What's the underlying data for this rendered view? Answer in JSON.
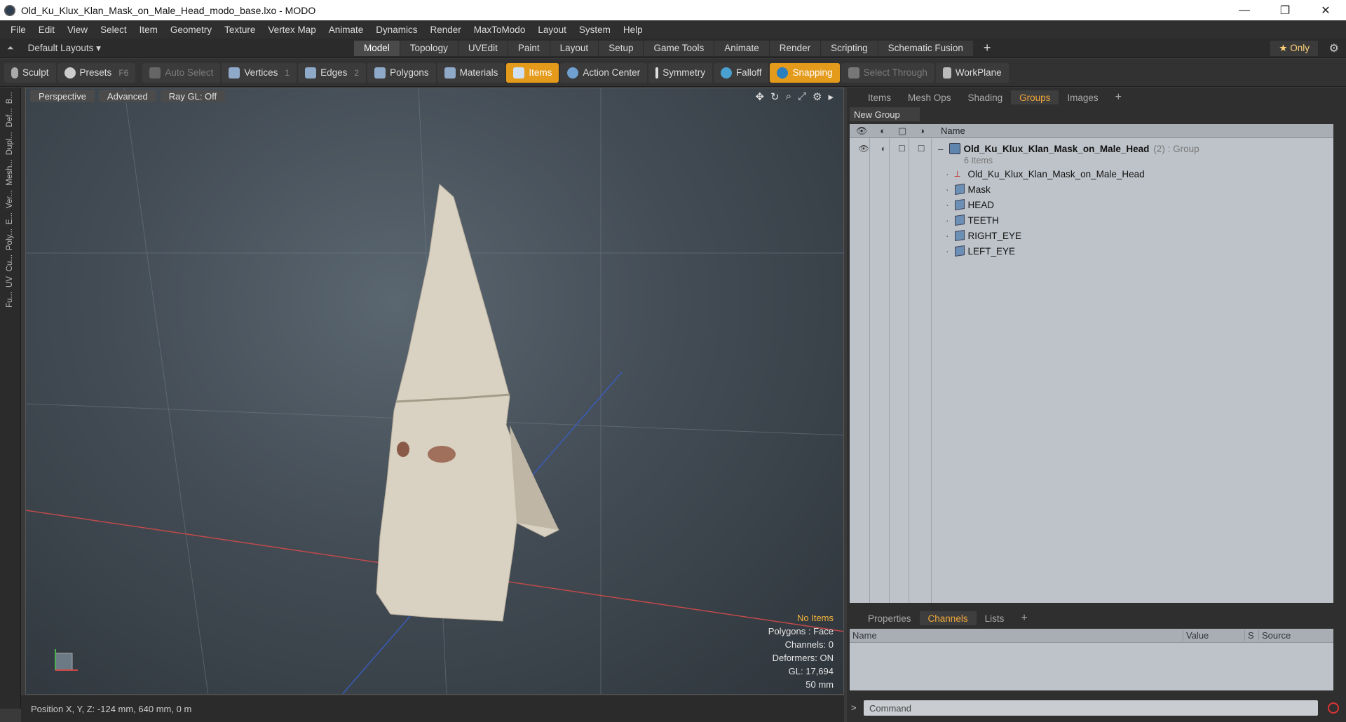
{
  "window": {
    "title": "Old_Ku_Klux_Klan_Mask_on_Male_Head_modo_base.lxo - MODO",
    "controls": [
      "—",
      "❐",
      "✕"
    ]
  },
  "menu": [
    "File",
    "Edit",
    "View",
    "Select",
    "Item",
    "Geometry",
    "Texture",
    "Vertex Map",
    "Animate",
    "Dynamics",
    "Render",
    "MaxToModo",
    "Layout",
    "System",
    "Help"
  ],
  "layouts_label": "Default Layouts ▾",
  "mode_tabs": [
    "Model",
    "Topology",
    "UVEdit",
    "Paint",
    "Layout",
    "Setup",
    "Game Tools",
    "Animate",
    "Render",
    "Scripting",
    "Schematic Fusion"
  ],
  "only_label": "★  Only",
  "toolbar": {
    "sculpt": "Sculpt",
    "presets": "Presets",
    "presets_key": "F6",
    "auto_select": "Auto Select",
    "vertices": "Vertices",
    "vertices_count": "1",
    "edges": "Edges",
    "edges_count": "2",
    "polygons": "Polygons",
    "materials": "Materials",
    "items": "Items",
    "action_center": "Action Center",
    "symmetry": "Symmetry",
    "falloff": "Falloff",
    "snapping": "Snapping",
    "select_through": "Select Through",
    "workplane": "WorkPlane"
  },
  "left_tools": [
    "B...",
    "Def...",
    "Dupl...",
    "Mesh...",
    "Ver...",
    "E...",
    "Poly...",
    "Cu...",
    "UV",
    "Fu..."
  ],
  "viewport": {
    "perspective": "Perspective",
    "advanced": "Advanced",
    "raygl": "Ray GL: Off",
    "info": {
      "no_items": "No Items",
      "polygons": "Polygons : Face",
      "channels": "Channels: 0",
      "deformers": "Deformers: ON",
      "gl": "GL: 17,694",
      "scale": "50 mm"
    }
  },
  "status": {
    "position": "Position X, Y, Z:  -124 mm, 640 mm, 0 m"
  },
  "right_tabs": [
    "Items",
    "Mesh Ops",
    "Shading",
    "Groups",
    "Images"
  ],
  "new_group": "New Group",
  "list_header": "Name",
  "group": {
    "name": "Old_Ku_Klux_Klan_Mask_on_Male_Head",
    "suffix": "(2) : Group",
    "count": "6 Items",
    "children": [
      "Old_Ku_Klux_Klan_Mask_on_Male_Head",
      "Mask",
      "HEAD",
      "TEETH",
      "RIGHT_EYE",
      "LEFT_EYE"
    ]
  },
  "bottom_tabs": [
    "Properties",
    "Channels",
    "Lists"
  ],
  "channels_cols": {
    "name": "Name",
    "value": "Value",
    "s": "S",
    "source": "Source"
  },
  "command_placeholder": "Command",
  "colors": {
    "accent": "#e49a1a",
    "active_tab_text": "#f3a83a",
    "info_highlight": "#f4b43a"
  }
}
